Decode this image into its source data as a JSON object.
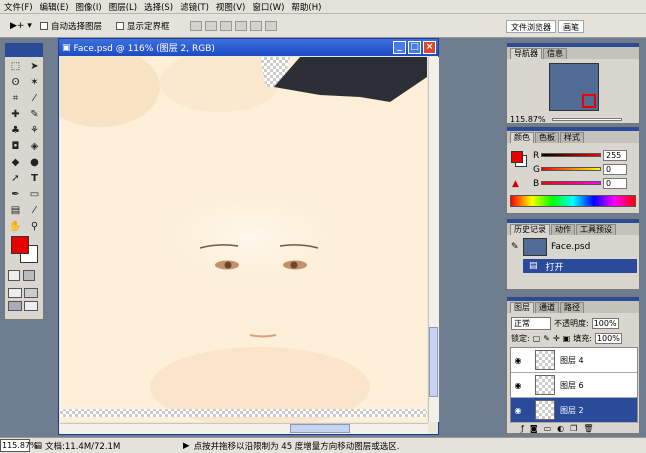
{
  "menu": [
    "文件(F)",
    "编辑(E)",
    "图像(I)",
    "图层(L)",
    "选择(S)",
    "滤镜(T)",
    "视图(V)",
    "窗口(W)",
    "帮助(H)"
  ],
  "options": {
    "auto_select": "自动选择图层",
    "show_bounds": "显示定界框",
    "tool": "▶+ ▾"
  },
  "well_tabs": [
    "文件浏览器",
    "画笔"
  ],
  "doc": {
    "title": "Face.psd @ 116% (图层 2, RGB)"
  },
  "status": {
    "zoom": "115.87%",
    "doc_info": "文档:11.4M/72.1M",
    "hint": "点按并拖移以沿限制为 45 度增量方向移动图层或选区."
  },
  "navigator": {
    "tabs": [
      "导航器",
      "信息"
    ],
    "zoom": "115.87%"
  },
  "color": {
    "tabs": [
      "颜色",
      "色板",
      "样式"
    ],
    "r_label": "R",
    "g_label": "G",
    "b_label": "B",
    "r": "255",
    "g": "0",
    "b": "0",
    "fg": "#e60000"
  },
  "history": {
    "tabs": [
      "历史记录",
      "动作",
      "工具预设"
    ],
    "snapshot": "Face.psd",
    "step": "打开"
  },
  "layers": {
    "tabs": [
      "图层",
      "通道",
      "路径"
    ],
    "mode": "正常",
    "opacity_label": "不透明度:",
    "opacity": "100%",
    "lock_label": "锁定:",
    "fill_label": "填充:",
    "fill": "100%",
    "items": [
      {
        "name": "图层 4"
      },
      {
        "name": "图层 6"
      },
      {
        "name": "图层 2"
      }
    ]
  },
  "icons": [
    "move-icon",
    "marquee-icon",
    "lasso-icon",
    "crop-icon",
    "brush-icon",
    "stamp-icon",
    "eraser-icon",
    "bucket-icon",
    "blur-icon",
    "dodge-icon",
    "path-select-icon",
    "type-icon",
    "pen-icon",
    "shape-icon",
    "notes-icon",
    "eyedropper-icon",
    "hand-icon",
    "zoom-icon"
  ]
}
